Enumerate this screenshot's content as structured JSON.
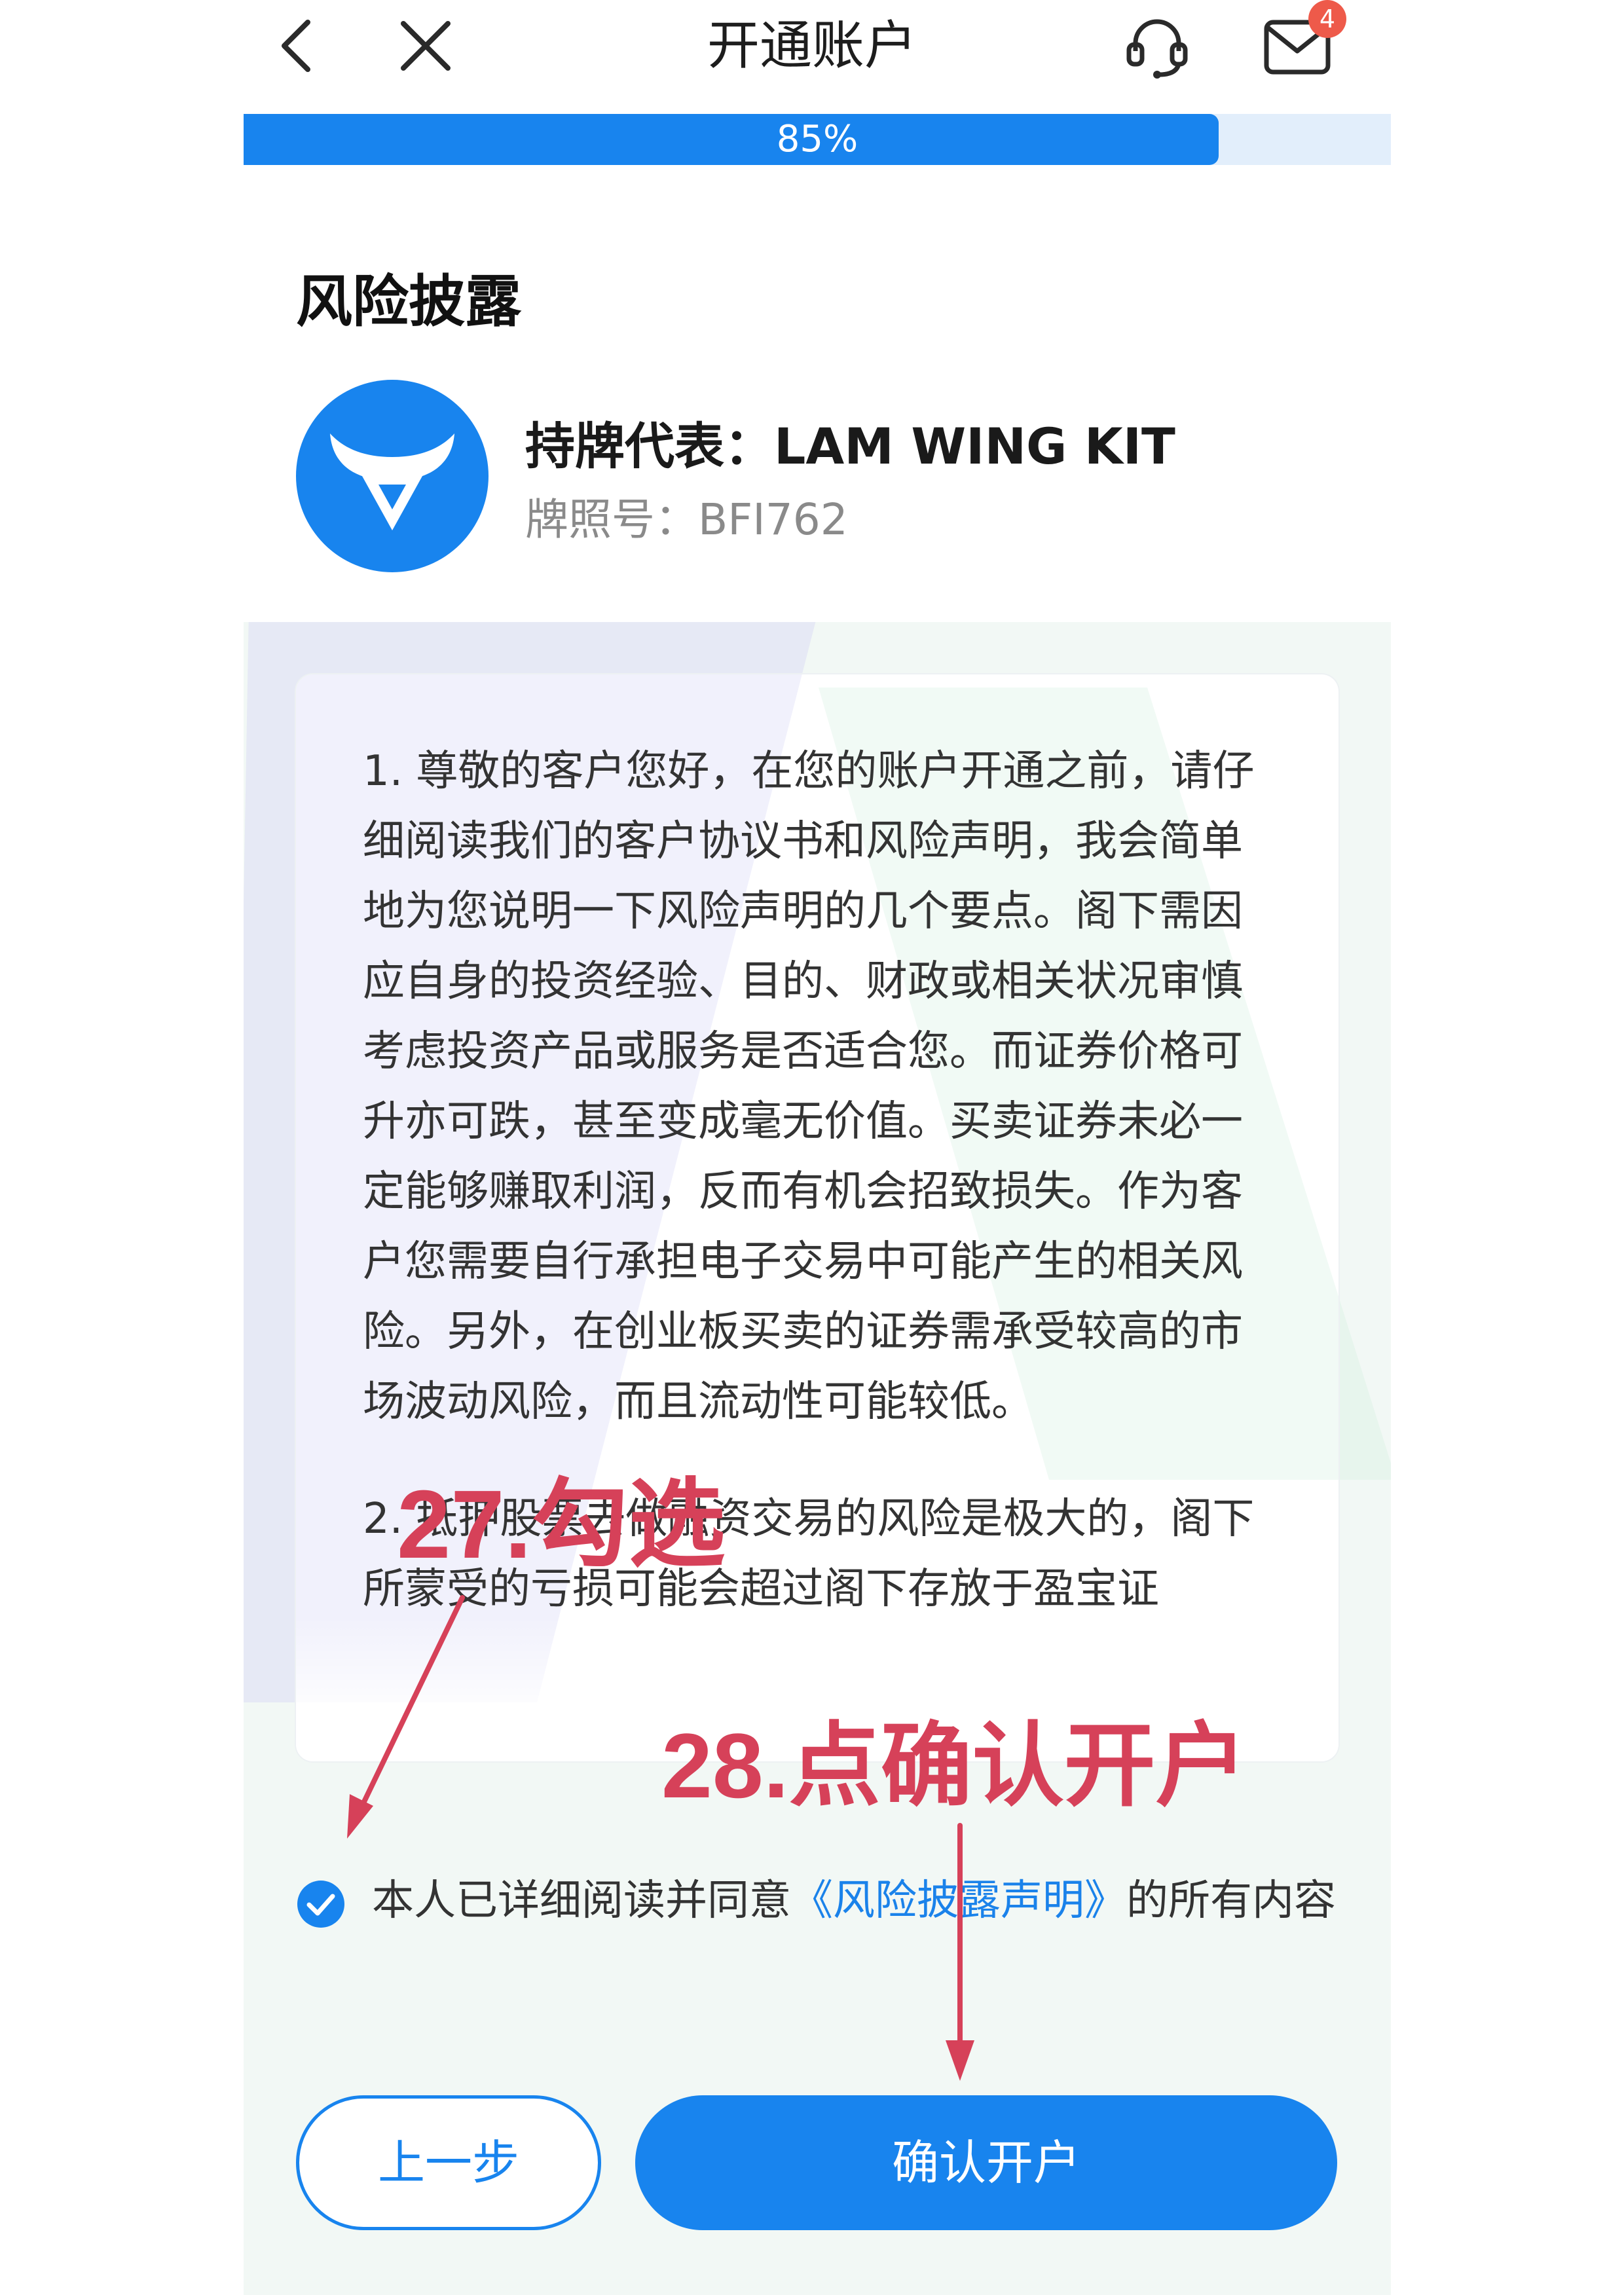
{
  "header": {
    "title": "开通账户",
    "notification_count": "4"
  },
  "progress": {
    "label": "85%",
    "value": 0.85
  },
  "section": {
    "title": "风险披露"
  },
  "representative": {
    "name_line": "持牌代表：LAM WING KIT",
    "license_line": "牌照号：BFI762"
  },
  "disclosure": {
    "paragraphs": [
      "1. 尊敬的客户您好，在您的账户开通之前，请仔细阅读我们的客户协议书和风险声明，我会简单地为您说明一下风险声明的几个要点。阁下需因应自身的投资经验、目的、财政或相关状况审慎考虑投资产品或服务是否适合您。而证券价格可升亦可跌，甚至变成毫无价值。买卖证券未必一定能够赚取利润，反而有机会招致损失。作为客户您需要自行承担电子交易中可能产生的相关风险。另外，在创业板买卖的证券需承受较高的市场波动风险，而且流动性可能较低。",
      "2. 抵押股票去做融资交易的风险是极大的，阁下所蒙受的亏损可能会超过阁下存放于盈宝证"
    ]
  },
  "agreement": {
    "checked": true,
    "prefix": "本人已详细阅读并同意",
    "link": "《风险披露声明》",
    "suffix": "的所有内容"
  },
  "buttons": {
    "prev_label": "上一步",
    "confirm_label": "确认开户"
  },
  "annotations": {
    "step27": "27.勾选",
    "step28": "28.点确认开户"
  },
  "colors": {
    "primary": "#1884ee",
    "annotation": "#d64159",
    "badge": "#ee5a4a"
  }
}
